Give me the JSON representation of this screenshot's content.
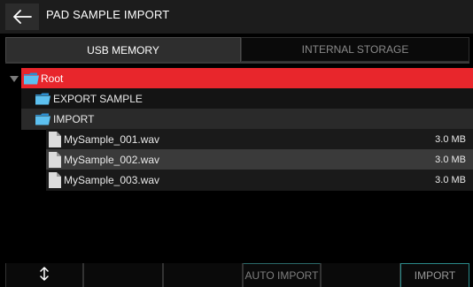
{
  "header": {
    "title": "PAD SAMPLE IMPORT",
    "back_icon": "back-arrow-icon"
  },
  "tabs": [
    {
      "label": "USB MEMORY",
      "selected": true
    },
    {
      "label": "INTERNAL STORAGE",
      "selected": false
    }
  ],
  "tree": {
    "root": {
      "label": "Root",
      "expanded": true,
      "selected": true
    },
    "folders": [
      {
        "label": "EXPORT SAMPLE",
        "expanded": false
      },
      {
        "label": "IMPORT",
        "expanded": true
      }
    ],
    "files": [
      {
        "name": "MySample_001.wav",
        "size": "3.0 MB",
        "highlighted": false
      },
      {
        "name": "MySample_002.wav",
        "size": "3.0 MB",
        "highlighted": true
      },
      {
        "name": "MySample_003.wav",
        "size": "3.0 MB",
        "highlighted": false
      }
    ]
  },
  "footer": {
    "sort_icon": "up-down-arrow-icon",
    "auto_import_label": "AUTO IMPORT",
    "import_label": "IMPORT"
  },
  "colors": {
    "selected_row": "#e8262c",
    "folder_blue": "#4fb0e8",
    "accent_teal": "#2a8a8a"
  }
}
